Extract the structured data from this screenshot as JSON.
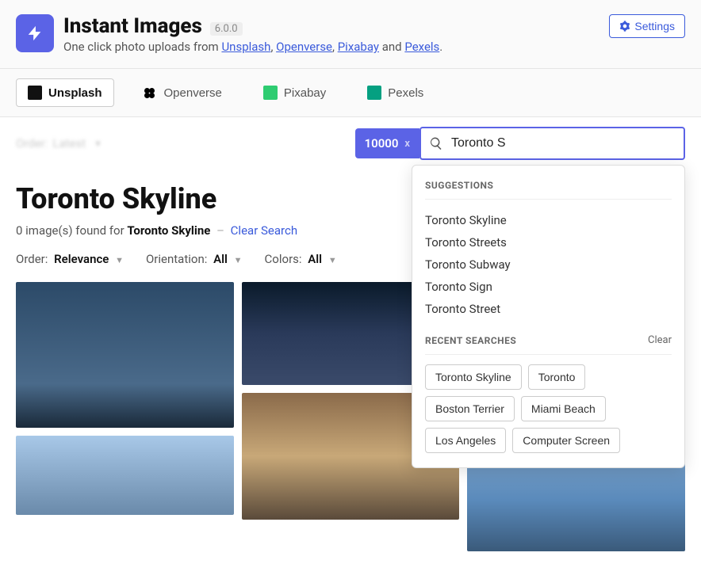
{
  "header": {
    "title": "Instant Images",
    "version": "6.0.0",
    "subtitle_prefix": "One click photo uploads from ",
    "links": [
      "Unsplash",
      "Openverse",
      "Pixabay",
      "Pexels"
    ],
    "subtitle_and": " and ",
    "settings_label": "Settings"
  },
  "tabs": [
    {
      "label": "Unsplash",
      "active": true
    },
    {
      "label": "Openverse",
      "active": false
    },
    {
      "label": "Pixabay",
      "active": false
    },
    {
      "label": "Pexels",
      "active": false
    }
  ],
  "toolbar": {
    "order_label": "Order:",
    "order_value": "Latest",
    "count": "10000",
    "count_close": "x",
    "search_value": "Toronto S"
  },
  "page": {
    "title": "Toronto Skyline",
    "results_prefix": "0 image(s) found for ",
    "results_term": "Toronto Skyline",
    "separator": "–",
    "clear_label": "Clear Search"
  },
  "filters": {
    "order_label": "Order:",
    "order_value": "Relevance",
    "orientation_label": "Orientation:",
    "orientation_value": "All",
    "colors_label": "Colors:",
    "colors_value": "All"
  },
  "dropdown": {
    "suggestions_heading": "SUGGESTIONS",
    "suggestions": [
      "Toronto Skyline",
      "Toronto Streets",
      "Toronto Subway",
      "Toronto Sign",
      "Toronto Street"
    ],
    "recent_heading": "RECENT SEARCHES",
    "clear_label": "Clear",
    "recent": [
      "Toronto Skyline",
      "Toronto",
      "Boston Terrier",
      "Miami Beach",
      "Los Angeles",
      "Computer Screen"
    ]
  }
}
